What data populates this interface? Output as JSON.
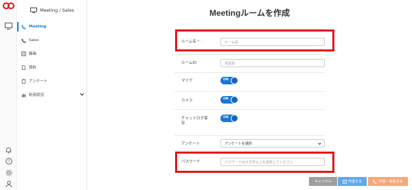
{
  "rail": {
    "icons": [
      "logo",
      "monitor-icon",
      "bell-icon",
      "help-icon",
      "gear-icon",
      "user-icon"
    ]
  },
  "sidebar": {
    "title": "Meeting / Sales",
    "items": [
      {
        "label": "Meeting",
        "icon": "phone-icon",
        "active": true
      },
      {
        "label": "Sales",
        "icon": "phone-icon"
      },
      {
        "label": "録画",
        "icon": "film-icon"
      },
      {
        "label": "資料",
        "icon": "document-icon"
      },
      {
        "label": "アンケート",
        "icon": "clipboard-icon"
      },
      {
        "label": "利用状況",
        "icon": "bar-chart-icon",
        "expandable": true
      }
    ]
  },
  "main": {
    "title": "Meetingルームを作成",
    "form": {
      "room_name": {
        "label": "ルーム名",
        "required_mark": "*",
        "placeholder": "ルーム名"
      },
      "room_id": {
        "label": "ルームID",
        "placeholder": "未設定"
      },
      "mic": {
        "label": "マイク",
        "toggle": "ON"
      },
      "camera": {
        "label": "カメラ",
        "toggle": "ON"
      },
      "chat_log": {
        "label_line1": "チャットログ保",
        "label_line2": "存",
        "toggle": "ON"
      },
      "survey": {
        "label": "アンケート",
        "selected": "アンケートを選択"
      },
      "password": {
        "label": "パスワード",
        "placeholder": "パスワードは６文字以上を設定してください"
      }
    },
    "buttons": {
      "cancel": "キャンセル",
      "create": "作成する",
      "create_join": "作成・参加する"
    }
  },
  "colors": {
    "accent": "#1976d2",
    "highlight": "#e0151b",
    "cancel": "#9e9e9e",
    "create": "#64a8e8",
    "create_join": "#f4a97a"
  }
}
